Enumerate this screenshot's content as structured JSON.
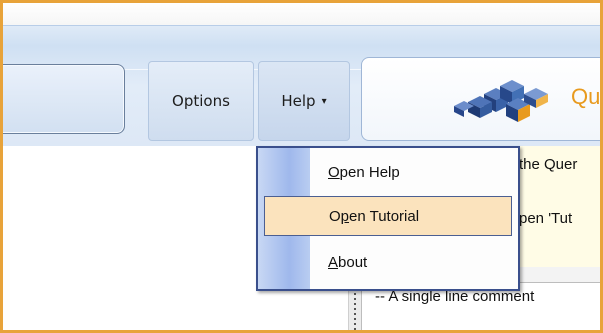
{
  "toolbar": {
    "options_label": "Options",
    "help_label": "Help",
    "help_arrow": "▾",
    "logo_text": "Qu"
  },
  "help_menu": {
    "items": [
      {
        "hotkey": "O",
        "rest": "pen Help",
        "highlighted": false
      },
      {
        "pre": "O",
        "hotkey": "p",
        "rest": "en Tutorial",
        "highlighted": true
      },
      {
        "hotkey": "A",
        "rest": "bout",
        "highlighted": false
      }
    ]
  },
  "editor": {
    "line1": "the Quer",
    "line2": "pen 'Tut",
    "comment": "-- A single line comment"
  },
  "colors": {
    "frame_border": "#e8a33a",
    "menu_border": "#3a4f8c",
    "menu_highlight": "#fbe3bd",
    "editor_bg": "#fffce6",
    "logo_text": "#e89a1e"
  },
  "icons": {
    "logo": "cube-logo-icon",
    "dropdown": "chevron-down-icon"
  }
}
